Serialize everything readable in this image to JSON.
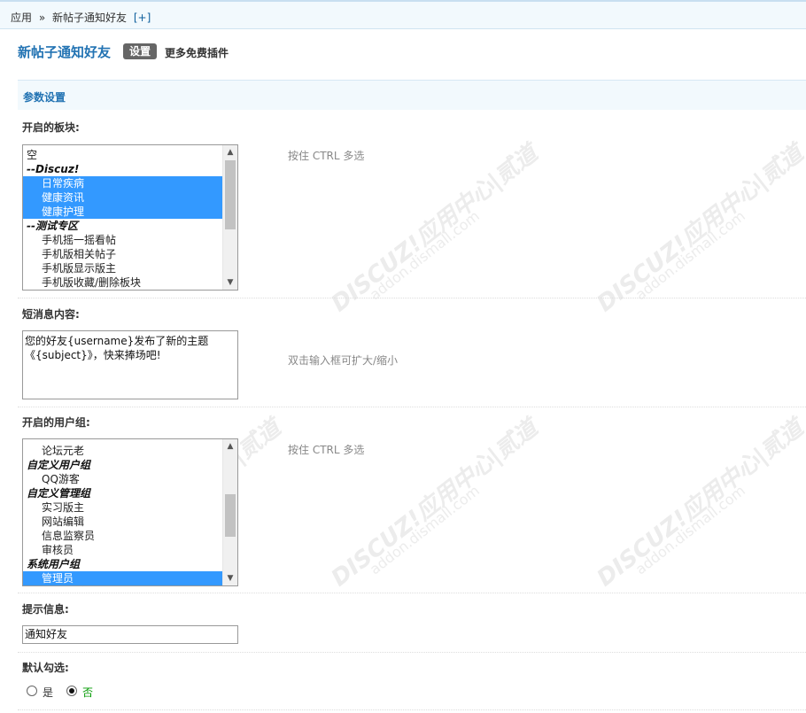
{
  "breadcrumb": {
    "root": "应用",
    "sep": "»",
    "current": "新帖子通知好友",
    "add": "[+]"
  },
  "header": {
    "title": "新帖子通知好友",
    "settings_tab": "设置",
    "more_plugins": "更多免费插件"
  },
  "section": {
    "title": "参数设置"
  },
  "fields": {
    "forums": {
      "label": "开启的板块:",
      "hint": "按住 CTRL 多选",
      "items": [
        {
          "text": "空",
          "type": "option0",
          "selected": false
        },
        {
          "text": "--Discuz!",
          "type": "group",
          "selected": false
        },
        {
          "text": "日常疾病",
          "type": "option",
          "selected": true
        },
        {
          "text": "健康资讯",
          "type": "option",
          "selected": true
        },
        {
          "text": "健康护理",
          "type": "option",
          "selected": true
        },
        {
          "text": "--测试专区",
          "type": "group",
          "selected": false
        },
        {
          "text": "手机摇一摇看帖",
          "type": "option",
          "selected": false
        },
        {
          "text": "手机版相关帖子",
          "type": "option",
          "selected": false
        },
        {
          "text": "手机版显示版主",
          "type": "option",
          "selected": false
        },
        {
          "text": "手机版收藏/删除板块",
          "type": "option",
          "selected": false
        }
      ]
    },
    "message": {
      "label": "短消息内容:",
      "hint": "双击输入框可扩大/缩小",
      "value": "您的好友{username}发布了新的主题\n《{subject}》，快来捧场吧!"
    },
    "usergroups": {
      "label": "开启的用户组:",
      "hint": "按住 CTRL 多选",
      "items": [
        {
          "text": "论坛元老",
          "type": "option",
          "selected": false
        },
        {
          "text": "自定义用户组",
          "type": "group",
          "selected": false
        },
        {
          "text": "QQ游客",
          "type": "option",
          "selected": false
        },
        {
          "text": "自定义管理组",
          "type": "group",
          "selected": false
        },
        {
          "text": "实习版主",
          "type": "option",
          "selected": false
        },
        {
          "text": "网站编辑",
          "type": "option",
          "selected": false
        },
        {
          "text": "信息监察员",
          "type": "option",
          "selected": false
        },
        {
          "text": "审核员",
          "type": "option",
          "selected": false
        },
        {
          "text": "系统用户组",
          "type": "group",
          "selected": false
        },
        {
          "text": "管理员",
          "type": "option",
          "selected": true
        }
      ]
    },
    "tip": {
      "label": "提示信息:",
      "value": "通知好友"
    },
    "default_check": {
      "label": "默认勾选:",
      "options": [
        "是",
        "否"
      ],
      "selected": "否"
    }
  },
  "watermark": {
    "brand": "DISCUZ!应用中心|贰道",
    "site": "addon.dismall.com"
  },
  "colors": {
    "accent": "#2273b3",
    "selection": "#3399ff",
    "section_bg": "#f2f9fd"
  },
  "icons": {
    "scroll_up": "chevron-up-icon",
    "scroll_down": "chevron-down-icon"
  }
}
